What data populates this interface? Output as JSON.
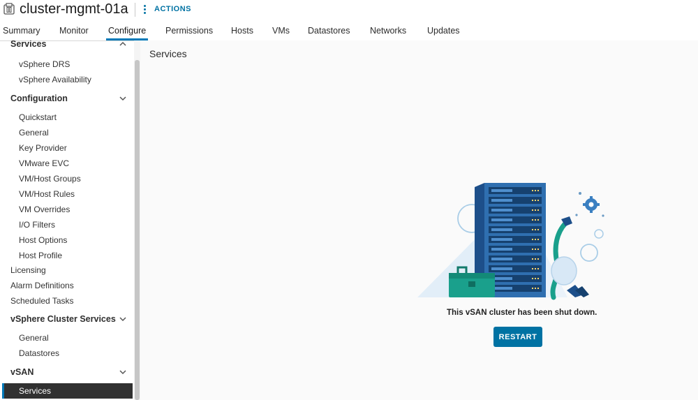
{
  "header": {
    "title": "cluster-mgmt-01a",
    "actions_label": "ACTIONS"
  },
  "tabs": [
    {
      "label": "Summary"
    },
    {
      "label": "Monitor"
    },
    {
      "label": "Configure",
      "active": true
    },
    {
      "label": "Permissions"
    },
    {
      "label": "Hosts"
    },
    {
      "label": "VMs"
    },
    {
      "label": "Datastores"
    },
    {
      "label": "Networks"
    },
    {
      "label": "Updates"
    }
  ],
  "sidebar": {
    "services_group": {
      "label": "Services",
      "items": [
        "vSphere DRS",
        "vSphere Availability"
      ]
    },
    "configuration_group": {
      "label": "Configuration",
      "items": [
        "Quickstart",
        "General",
        "Key Provider",
        "VMware EVC",
        "VM/Host Groups",
        "VM/Host Rules",
        "VM Overrides",
        "I/O Filters",
        "Host Options",
        "Host Profile"
      ]
    },
    "top_items": [
      "Licensing",
      "Alarm Definitions",
      "Scheduled Tasks"
    ],
    "cluster_services_group": {
      "label": "vSphere Cluster Services",
      "items": [
        "General",
        "Datastores"
      ]
    },
    "vsan_group": {
      "label": "vSAN",
      "items": [
        "Services"
      ]
    }
  },
  "main": {
    "title": "Services",
    "message": "This vSAN cluster has been shut down.",
    "restart_label": "RESTART"
  },
  "colors": {
    "accent": "#0072a3",
    "active_nav_bg": "#313131",
    "rack_blue": "#2f6fb0",
    "toolbox_teal": "#1aa08c"
  }
}
